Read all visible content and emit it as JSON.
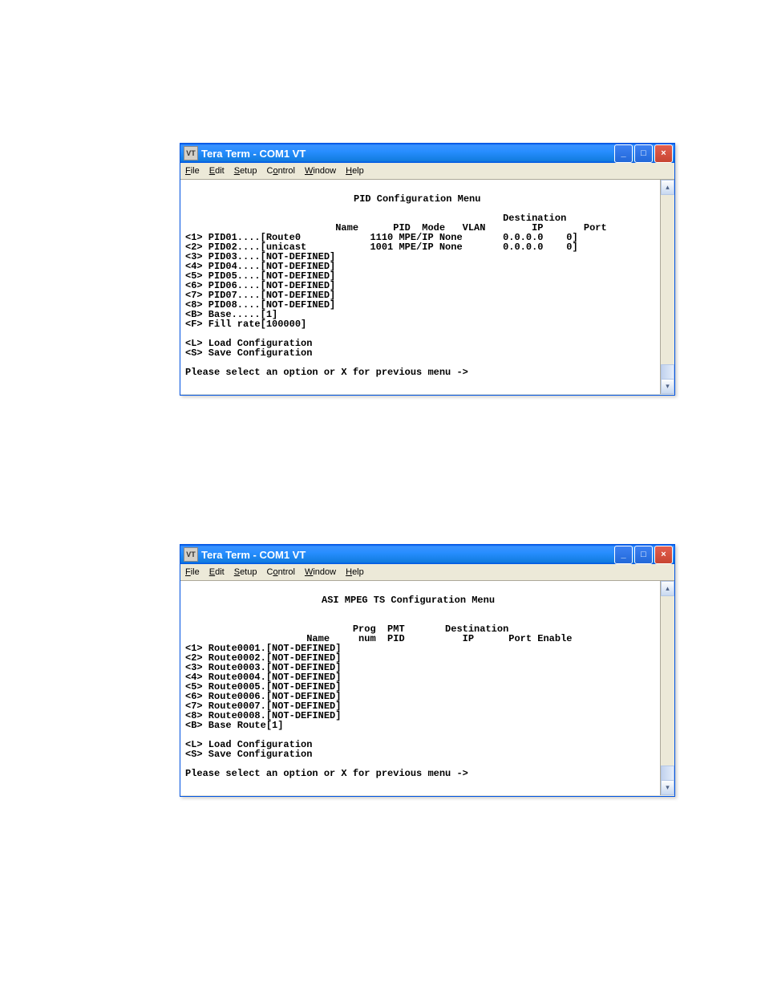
{
  "windows": [
    {
      "title": "Tera Term - COM1 VT",
      "menu": [
        "File",
        "Edit",
        "Setup",
        "Control",
        "Window",
        "Help"
      ],
      "heading": "PID Configuration Menu",
      "colhdr1": "                                                       Destination",
      "colhdr2": "                          Name      PID  Mode   VLAN        IP       Port",
      "rows": [
        "<1> PID01....[Route0            1110 MPE/IP None       0.0.0.0    0]",
        "<2> PID02....[unicast           1001 MPE/IP None       0.0.0.0    0]",
        "<3> PID03....[NOT-DEFINED]",
        "<4> PID04....[NOT-DEFINED]",
        "<5> PID05....[NOT-DEFINED]",
        "<6> PID06....[NOT-DEFINED]",
        "<7> PID07....[NOT-DEFINED]",
        "<8> PID08....[NOT-DEFINED]",
        "<B> Base.....[1]",
        "<F> Fill rate[100000]"
      ],
      "actions": [
        "<L> Load Configuration",
        "<S> Save Configuration"
      ],
      "prompt": "Please select an option or X for previous menu ->"
    },
    {
      "title": "Tera Term - COM1 VT",
      "menu": [
        "File",
        "Edit",
        "Setup",
        "Control",
        "Window",
        "Help"
      ],
      "heading": "ASI MPEG TS Configuration Menu",
      "colhdr1": "                             Prog  PMT       Destination",
      "colhdr2": "                     Name     num  PID          IP      Port Enable",
      "rows": [
        "<1> Route0001.[NOT-DEFINED]",
        "<2> Route0002.[NOT-DEFINED]",
        "<3> Route0003.[NOT-DEFINED]",
        "<4> Route0004.[NOT-DEFINED]",
        "<5> Route0005.[NOT-DEFINED]",
        "<6> Route0006.[NOT-DEFINED]",
        "<7> Route0007.[NOT-DEFINED]",
        "<8> Route0008.[NOT-DEFINED]",
        "<B> Base Route[1]"
      ],
      "actions": [
        "<L> Load Configuration",
        "<S> Save Configuration"
      ],
      "prompt": "Please select an option or X for previous menu ->"
    }
  ]
}
